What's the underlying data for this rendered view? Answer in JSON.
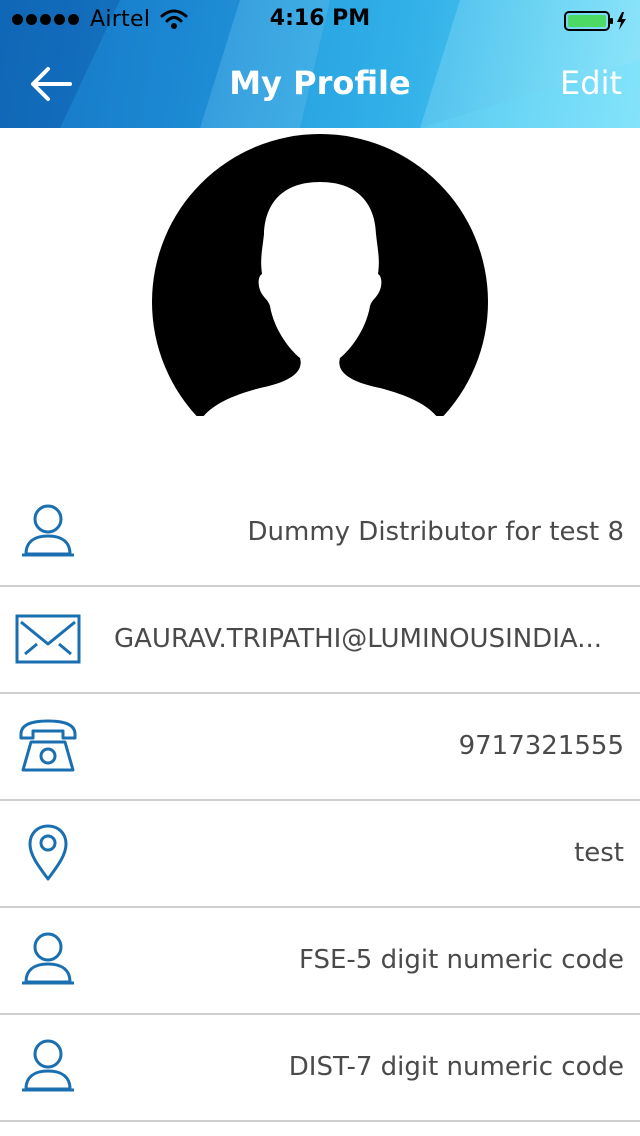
{
  "status_bar": {
    "carrier": "Airtel",
    "time": "4:16 PM",
    "signal_bars": 5,
    "battery_level": 1.0,
    "battery_color": "#4cd964"
  },
  "header": {
    "title": "My Profile",
    "edit_label": "Edit",
    "back_icon": "arrow-left-icon",
    "gradient_colors": [
      "#1470c0",
      "#34b4ea",
      "#7fe2fa"
    ]
  },
  "avatar": {
    "icon": "user-silhouette-icon"
  },
  "profile_rows": [
    {
      "icon": "person-icon",
      "value": "Dummy Distributor for test 8"
    },
    {
      "icon": "envelope-icon",
      "value": "GAURAV.TRIPATHI@LUMINOUSINDIA..."
    },
    {
      "icon": "phone-icon",
      "value": "9717321555"
    },
    {
      "icon": "location-pin-icon",
      "value": "test"
    },
    {
      "icon": "person-icon",
      "value": "FSE-5 digit numeric code"
    },
    {
      "icon": "person-icon",
      "value": "DIST-7 digit numeric code"
    }
  ],
  "colors": {
    "icon_blue": "#1a6fb0",
    "text_gray": "#4a4a4a",
    "divider": "#cfcfcf"
  }
}
